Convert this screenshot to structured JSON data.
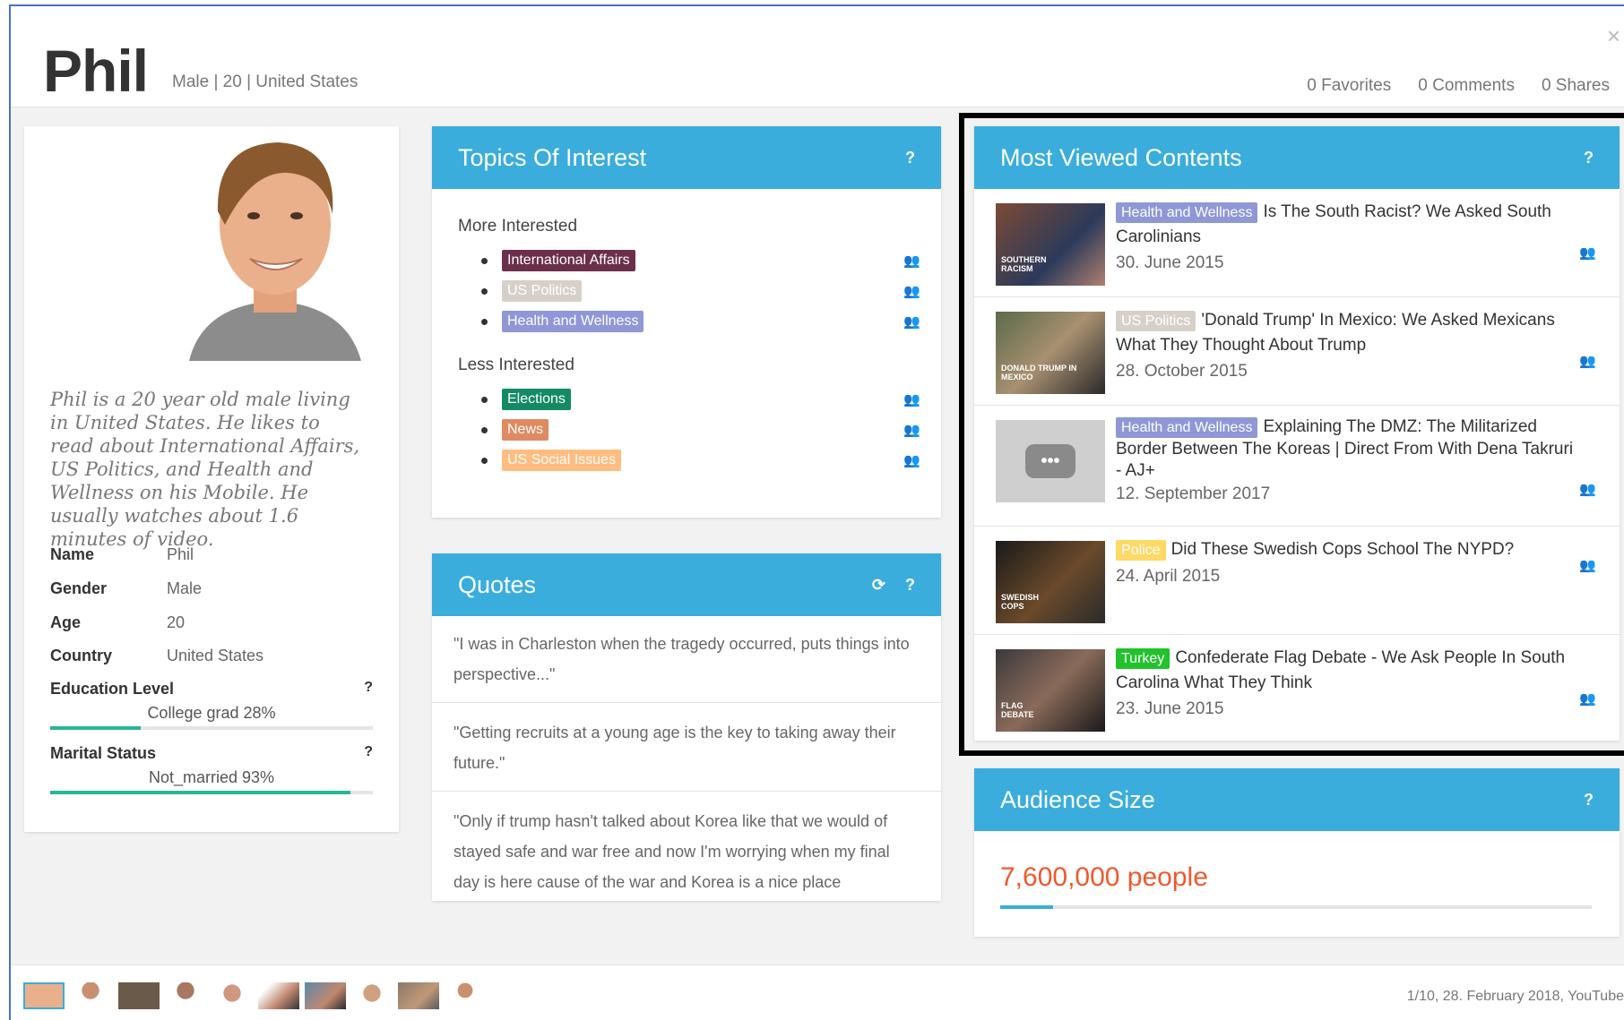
{
  "header": {
    "name": "Phil",
    "subinfo": "Male | 20 | United States",
    "favorites": "0 Favorites",
    "comments": "0 Comments",
    "shares": "0 Shares",
    "close": "×"
  },
  "profile": {
    "bio": "Phil is a 20 year old male living in United States. He likes to read about International Affairs, US Politics, and Health and Wellness on his Mobile. He usually watches about 1.6 minutes of video.",
    "attributes": [
      {
        "key": "Name",
        "value": "Phil"
      },
      {
        "key": "Gender",
        "value": "Male"
      },
      {
        "key": "Age",
        "value": "20"
      },
      {
        "key": "Country",
        "value": "United States"
      }
    ],
    "education": {
      "label": "Education Level",
      "help": "?",
      "value": "College grad 28%",
      "fraction": 0.28
    },
    "marital": {
      "label": "Marital Status",
      "help": "?",
      "value": "Not_married 93%",
      "fraction": 0.93
    }
  },
  "topics": {
    "title": "Topics Of Interest",
    "help": "?",
    "more_label": "More Interested",
    "less_label": "Less Interested",
    "more": [
      {
        "label": "International Affairs",
        "color": "#6b2f4c"
      },
      {
        "label": "US Politics",
        "color": "#d7d0c8"
      },
      {
        "label": "Health and Wellness",
        "color": "#8f97d6"
      }
    ],
    "less": [
      {
        "label": "Elections",
        "color": "#138a64"
      },
      {
        "label": "News",
        "color": "#e08a62"
      },
      {
        "label": "US Social Issues",
        "color": "#ffbe80"
      }
    ]
  },
  "quotes": {
    "title": "Quotes",
    "refresh": "⟳",
    "help": "?",
    "items": [
      "\"I was in Charleston when the tragedy occurred, puts things into perspective...\"",
      "\"Getting recruits at a young age is the key to taking away their future.\"",
      "\"Only if trump hasn't talked about Korea like that we would of stayed safe and war free and now I'm worrying when my final day is here cause of the war and Korea is a nice place"
    ]
  },
  "most_viewed": {
    "title": "Most Viewed Contents",
    "help": "?",
    "items": [
      {
        "tag": "Health and Wellness",
        "tag_color": "#8f97d6",
        "title": "Is The South Racist? We Asked South Carolinians",
        "date": "30. June 2015",
        "thumb_caption": "SOUTHERN RACISM"
      },
      {
        "tag": "US Politics",
        "tag_color": "#d7d0c8",
        "title": "'Donald Trump' In Mexico: We Asked Mexicans What They Thought About Trump",
        "date": "28. October 2015",
        "thumb_caption": "DONALD TRUMP IN MEXICO"
      },
      {
        "tag": "Health and Wellness",
        "tag_color": "#8f97d6",
        "title": "Explaining The DMZ: The Militarized Border Between The Koreas | Direct From With Dena Takruri - AJ+",
        "date": "12. September 2017",
        "thumb_caption": ""
      },
      {
        "tag": "Police",
        "tag_color": "#ffd866",
        "title": "Did These Swedish Cops School The NYPD?",
        "date": "24. April 2015",
        "thumb_caption": "SWEDISH COPS"
      },
      {
        "tag": "Turkey",
        "tag_color": "#22c22b",
        "title": "Confederate Flag Debate - We Ask People In South Carolina What They Think",
        "date": "23. June 2015",
        "thumb_caption": "FLAG DEBATE"
      }
    ]
  },
  "audience": {
    "title": "Audience Size",
    "help": "?",
    "value": "7,600,000 people",
    "fraction": 0.09
  },
  "footer": {
    "pagination": "1/10, 28. February 2018, YouTube"
  }
}
